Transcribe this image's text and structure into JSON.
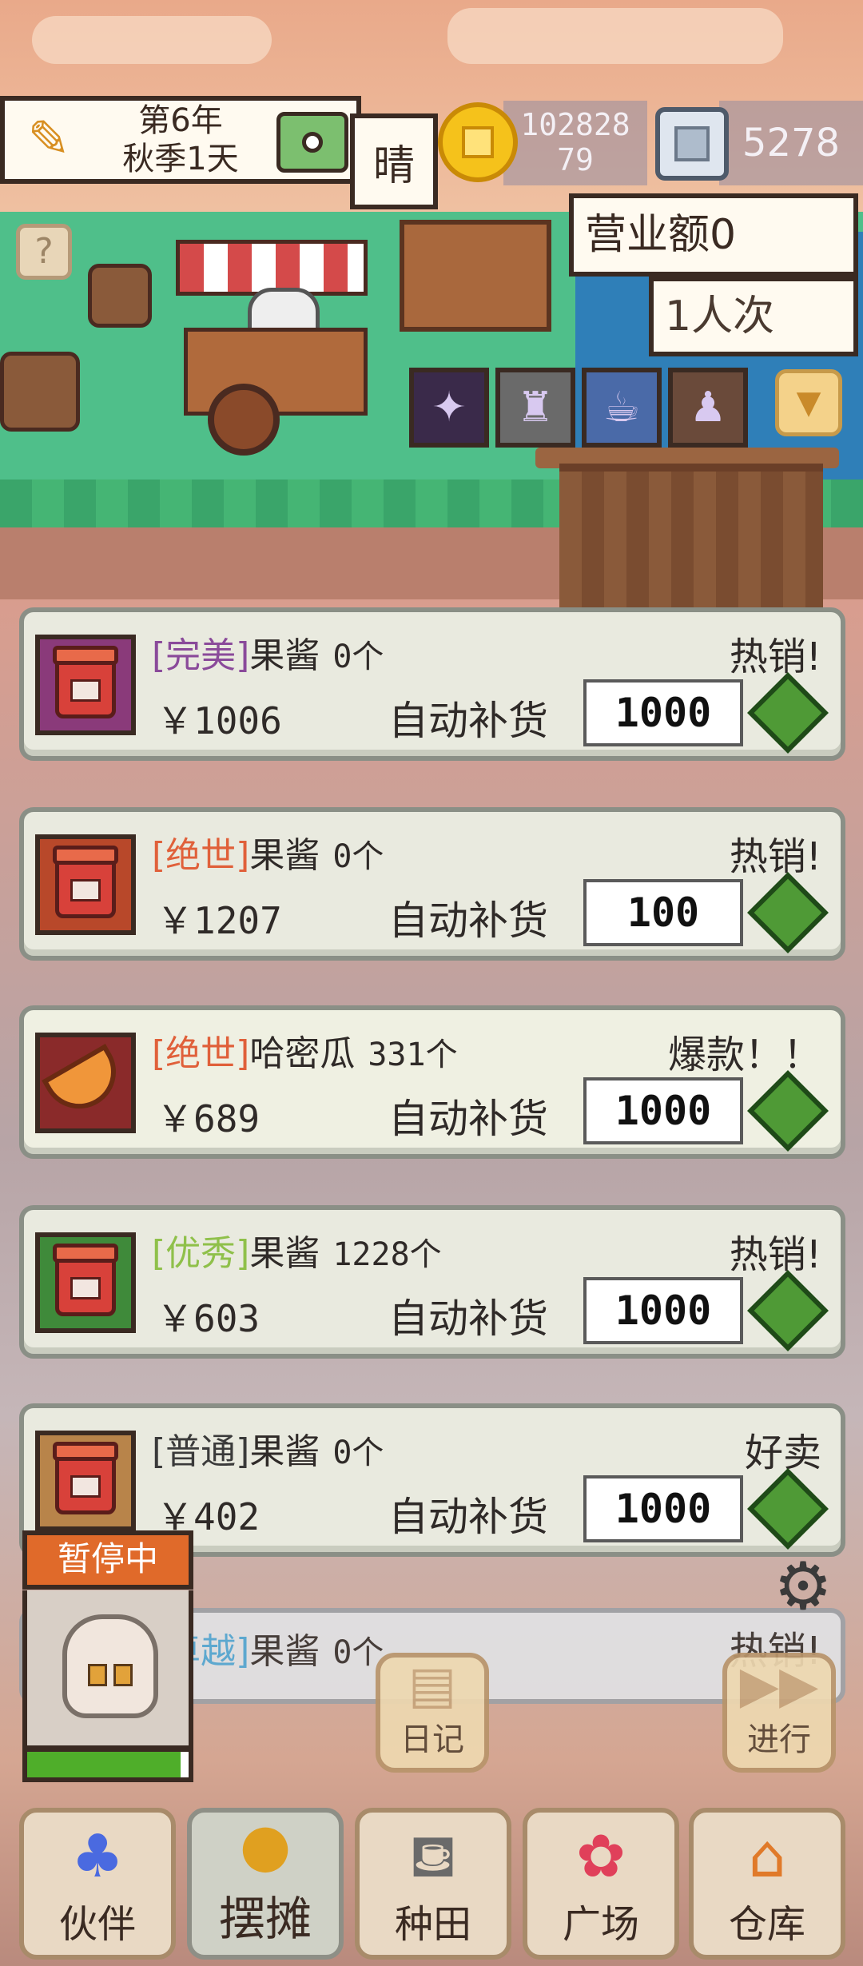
{
  "hud": {
    "year": "第6年",
    "season_day": "秋季1天",
    "weather": "晴",
    "money_line1": "102828",
    "money_line2": "79",
    "gems": "5278",
    "revenue": "营业额0",
    "visitors": "1人次",
    "help_glyph": "?"
  },
  "items": [
    {
      "grade": "[完美]",
      "grade_color": "#8a4a9a",
      "name": "果酱",
      "count": "0个",
      "status": "热销!",
      "price": "￥1006",
      "auto_label": "自动补货",
      "qty": "1000",
      "thumb_bg": "#8a3a7a",
      "icon": "jar"
    },
    {
      "grade": "[绝世]",
      "grade_color": "#e0603a",
      "name": "果酱",
      "count": "0个",
      "status": "热销!",
      "price": "￥1207",
      "auto_label": "自动补货",
      "qty": "100",
      "thumb_bg": "#b8482a",
      "icon": "jar"
    },
    {
      "grade": "[绝世]",
      "grade_color": "#e0603a",
      "name": "哈密瓜",
      "count": "331个",
      "status": "爆款！！",
      "price": "￥689",
      "auto_label": "自动补货",
      "qty": "1000",
      "thumb_bg": "#8a2a2a",
      "icon": "melon"
    },
    {
      "grade": "[优秀]",
      "grade_color": "#8fc04a",
      "name": "果酱",
      "count": "1228个",
      "status": "热销!",
      "price": "￥603",
      "auto_label": "自动补货",
      "qty": "1000",
      "thumb_bg": "#3f8a3a",
      "icon": "jar"
    },
    {
      "grade": "[普通]",
      "grade_color": "#3a3a3a",
      "name": "果酱",
      "count": "0个",
      "status": "好卖",
      "price": "￥402",
      "auto_label": "自动补货",
      "qty": "1000",
      "thumb_bg": "#b8844a",
      "icon": "jar"
    }
  ],
  "partial_item": {
    "grade": "[卓越]",
    "grade_color": "#4aa8d8",
    "name": "果酱",
    "count": "0个",
    "status": "热销!"
  },
  "character": {
    "paused_label": "暂停中",
    "energy": 0.95
  },
  "actions": {
    "diary": "日记",
    "proceed": "进行"
  },
  "nav": [
    {
      "label": "伙伴",
      "icon": "companion-icon"
    },
    {
      "label": "摆摊",
      "icon": "stall-icon"
    },
    {
      "label": "种田",
      "icon": "watering-can-icon"
    },
    {
      "label": "广场",
      "icon": "flower-icon"
    },
    {
      "label": "仓库",
      "icon": "warehouse-icon"
    }
  ]
}
